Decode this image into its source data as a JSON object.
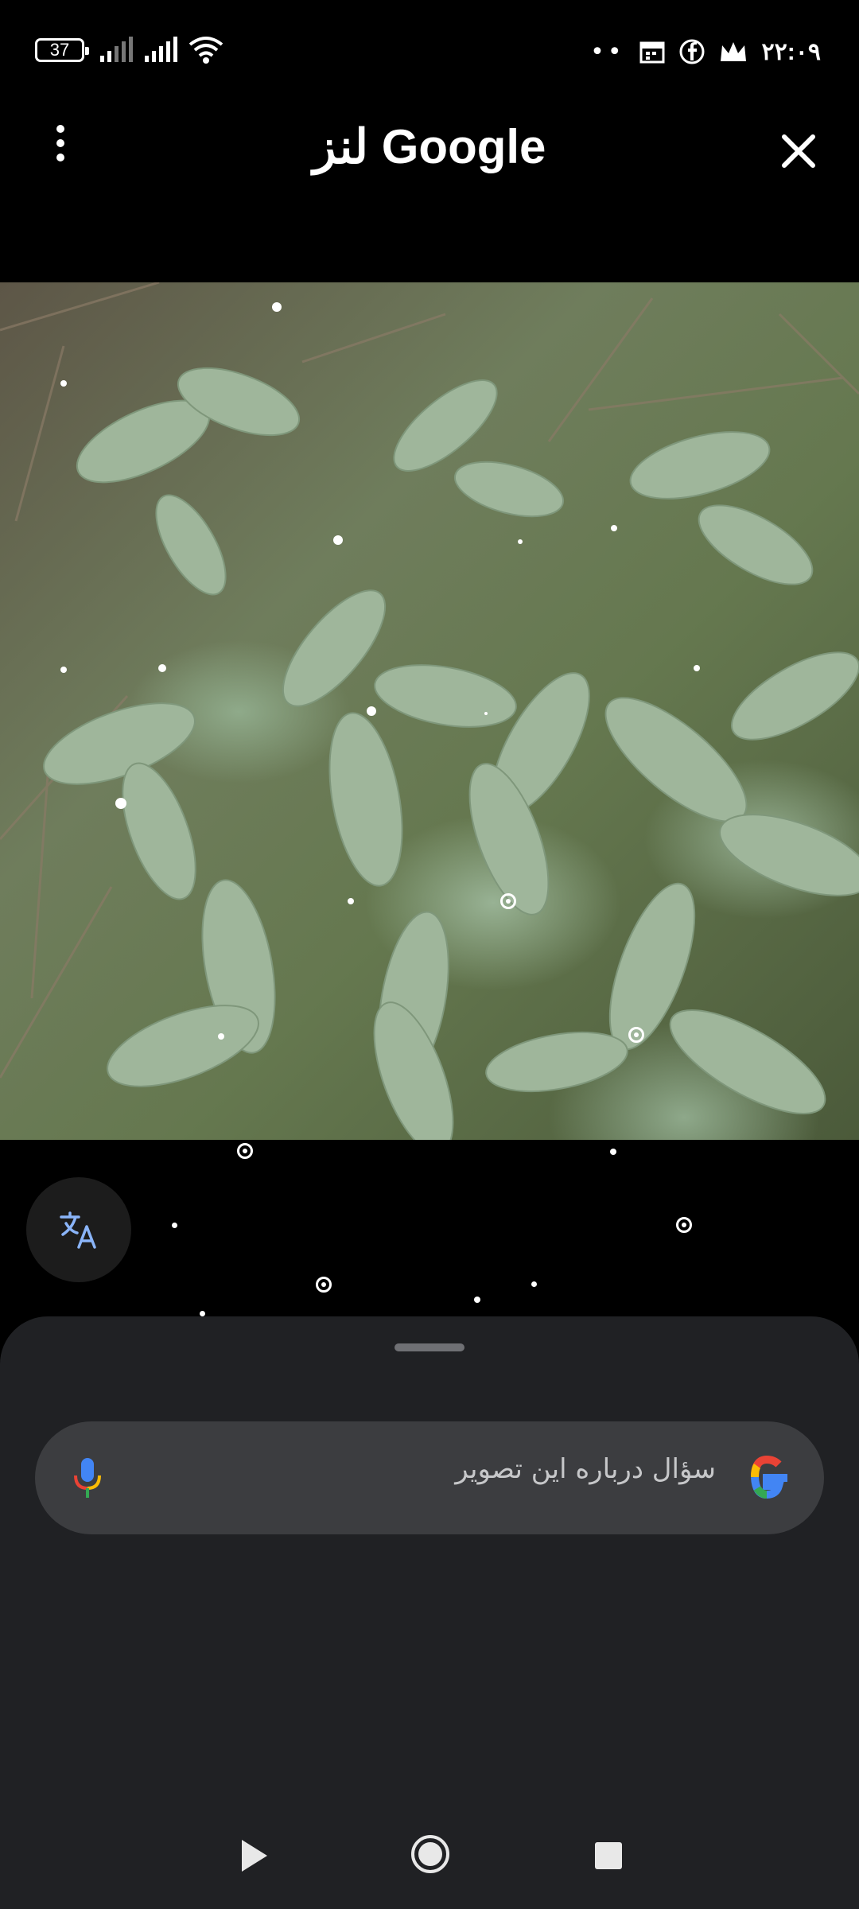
{
  "status_bar": {
    "battery": "37",
    "time": "۲۲:۰۹",
    "more": "••",
    "icons": [
      "signal-icon",
      "signal-icon",
      "wifi-icon",
      "calendar-icon",
      "facebook-icon",
      "crown-icon"
    ]
  },
  "header": {
    "title": "لنز Google",
    "menu_icon": "more-vert-icon",
    "close_icon": "close-icon"
  },
  "image": {
    "description_icon": "photo"
  },
  "translate": {
    "icon": "translate-icon"
  },
  "search": {
    "placeholder": "سؤال درباره این تصویر",
    "mic_icon": "mic-icon",
    "logo_icon": "google-logo-icon"
  },
  "navbar": {
    "icons": [
      "back-icon",
      "home-icon",
      "recents-icon"
    ]
  },
  "colors": {
    "background": "#000000",
    "sheet": "#202124",
    "search_bar": "#3c3d40",
    "translate_icon": "#8ab4f8"
  }
}
